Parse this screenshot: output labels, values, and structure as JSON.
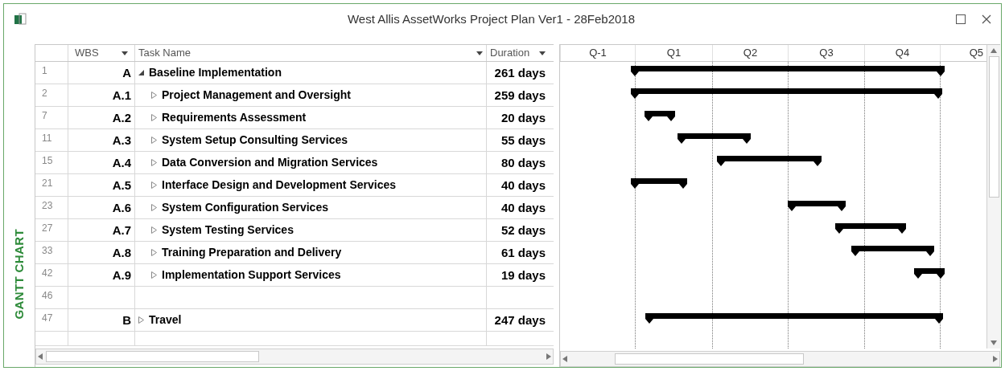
{
  "window": {
    "title": "West Allis AssetWorks Project Plan Ver1 - 28Feb2018"
  },
  "view_label": "GANTT CHART",
  "table": {
    "columns": [
      {
        "label": "WBS"
      },
      {
        "label": "Task Name"
      },
      {
        "label": "Duration"
      }
    ],
    "rows": [
      {
        "id": "1",
        "wbs": "A",
        "name": "Baseline Implementation",
        "duration": "261 days",
        "expanded": true,
        "children": [
          {
            "id": "2",
            "wbs": "A.1",
            "name": "Project Management and Oversight",
            "duration": "259 days",
            "expanded": false
          },
          {
            "id": "7",
            "wbs": "A.2",
            "name": "Requirements Assessment",
            "duration": "20 days",
            "expanded": false
          },
          {
            "id": "11",
            "wbs": "A.3",
            "name": "System Setup Consulting Services",
            "duration": "55 days",
            "expanded": false
          },
          {
            "id": "15",
            "wbs": "A.4",
            "name": "Data Conversion and Migration Services",
            "duration": "80 days",
            "expanded": false
          },
          {
            "id": "21",
            "wbs": "A.5",
            "name": "Interface Design and Development Services",
            "duration": "40 days",
            "expanded": false
          },
          {
            "id": "23",
            "wbs": "A.6",
            "name": "System Configuration Services",
            "duration": "40 days",
            "expanded": false
          },
          {
            "id": "27",
            "wbs": "A.7",
            "name": "System Testing Services",
            "duration": "52 days",
            "expanded": false
          },
          {
            "id": "33",
            "wbs": "A.8",
            "name": "Training Preparation and Delivery",
            "duration": "61 days",
            "expanded": false
          },
          {
            "id": "42",
            "wbs": "A.9",
            "name": "Implementation Support Services",
            "duration": "19 days",
            "expanded": false
          }
        ]
      },
      {
        "id": "46"
      },
      {
        "id": "47",
        "wbs": "B",
        "name": "Travel",
        "duration": "247 days",
        "expanded": false
      }
    ]
  },
  "timescale": [
    "Q-1",
    "Q1",
    "Q2",
    "Q3",
    "Q4",
    "Q5"
  ]
}
